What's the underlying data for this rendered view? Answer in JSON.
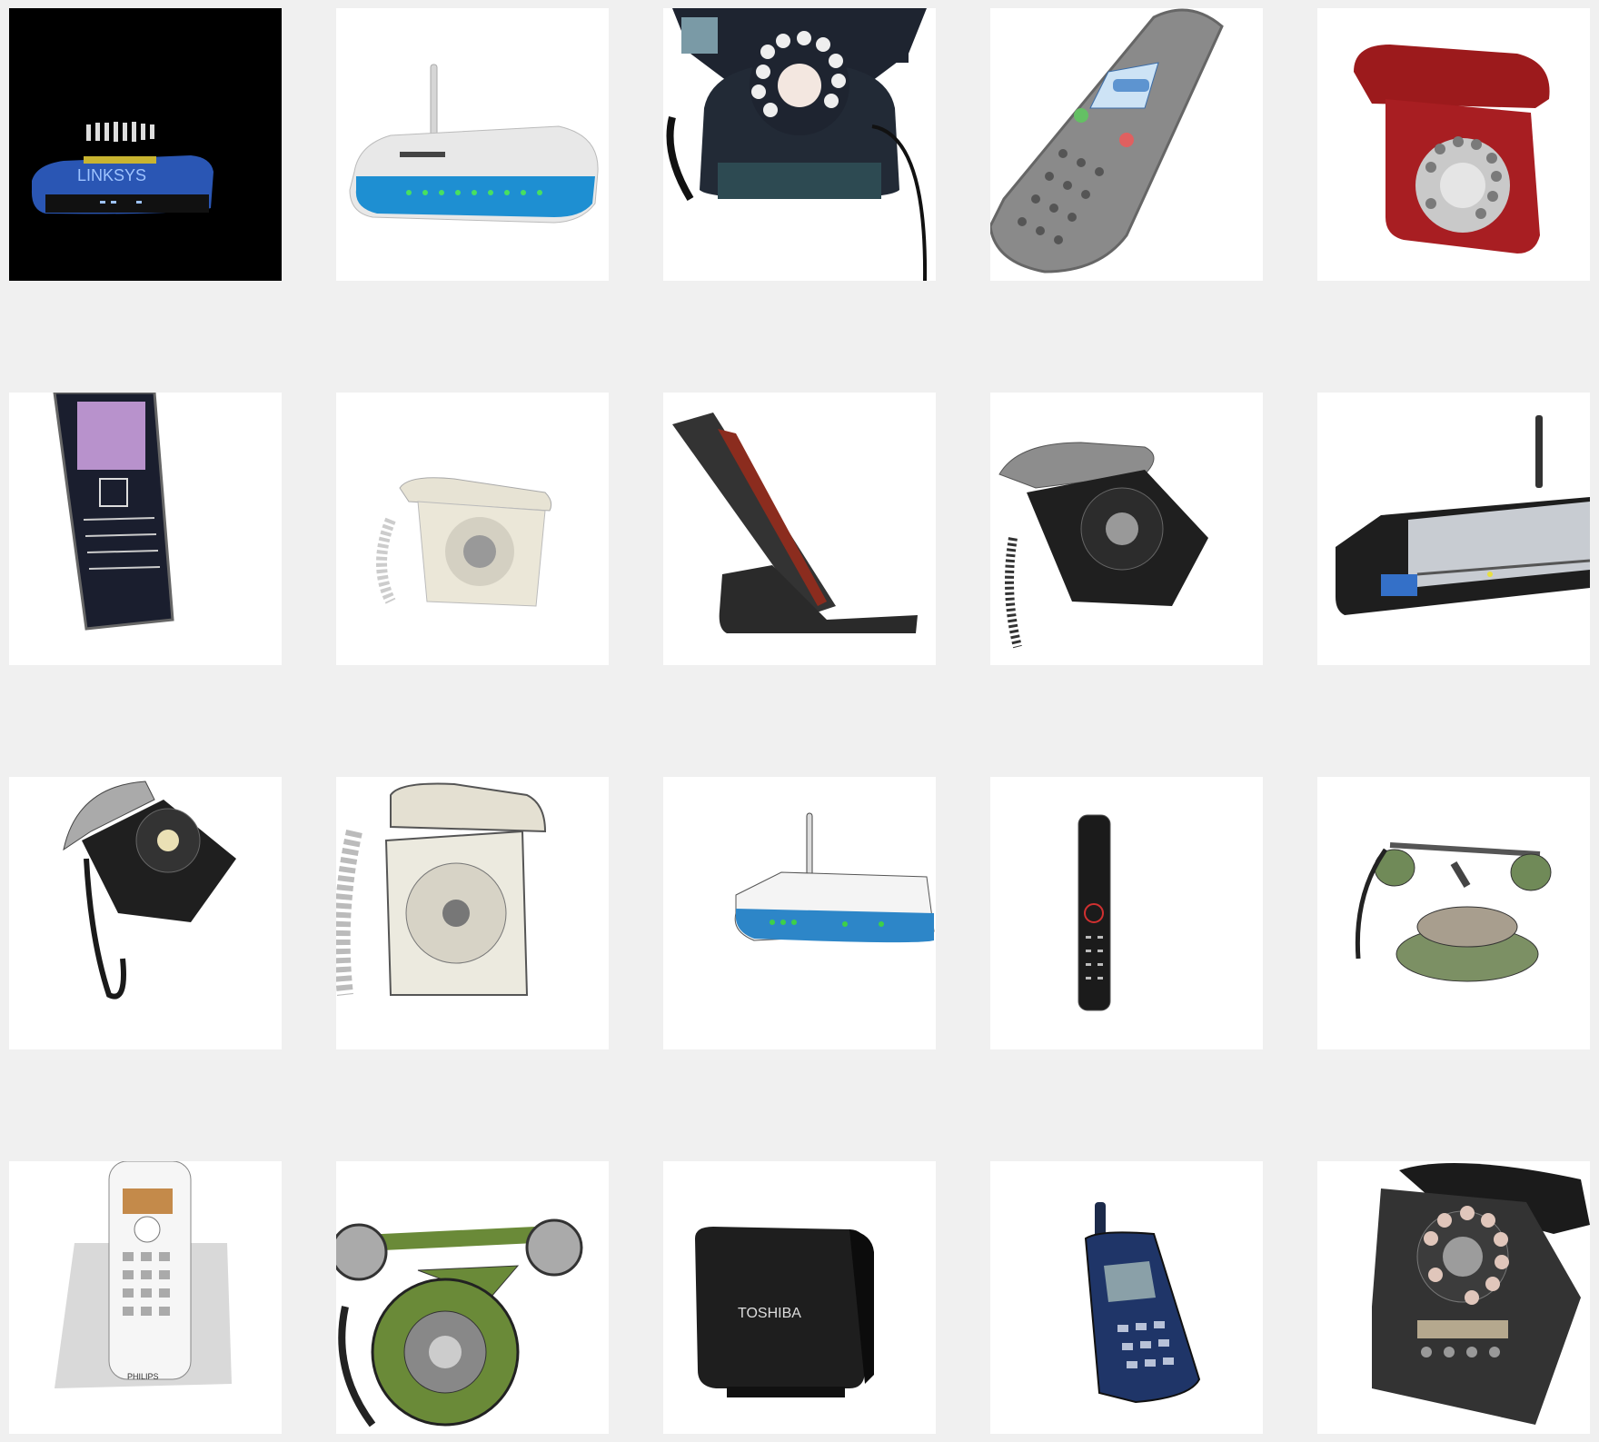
{
  "gallery": {
    "background": "#f0f0f0",
    "tiles": [
      {
        "name": "linksys-router",
        "logo": "LINKSYS",
        "background": "#000000"
      },
      {
        "name": "wifi-router-white",
        "background": "#ffffff"
      },
      {
        "name": "black-rotary-phone",
        "background": "#ffffff"
      },
      {
        "name": "grey-cordless-handset",
        "background": "#ffffff"
      },
      {
        "name": "red-rotary-phone",
        "background": "#ffffff"
      },
      {
        "name": "purple-screen-handset",
        "background": "#ffffff"
      },
      {
        "name": "cream-rotary-phone",
        "background": "#ffffff"
      },
      {
        "name": "cordless-stand",
        "background": "#ffffff"
      },
      {
        "name": "black-rotary-phone-grey-handset",
        "background": "#ffffff"
      },
      {
        "name": "dlink-router",
        "background": "#ffffff"
      },
      {
        "name": "black-rotary-phone-small",
        "background": "#ffffff"
      },
      {
        "name": "cream-rotary-phone-large",
        "background": "#ffffff"
      },
      {
        "name": "blue-wifi-router",
        "background": "#ffffff"
      },
      {
        "name": "black-handset-slim",
        "background": "#ffffff"
      },
      {
        "name": "green-antique-phone",
        "background": "#ffffff"
      },
      {
        "name": "philips-cordless-phone",
        "logo": "PHILIPS",
        "background": "#ffffff"
      },
      {
        "name": "green-candlestick-phone",
        "background": "#ffffff"
      },
      {
        "name": "toshiba-media-box",
        "logo": "TOSHIBA",
        "background": "#ffffff"
      },
      {
        "name": "blue-mobile-phone",
        "background": "#ffffff"
      },
      {
        "name": "black-retro-phone",
        "background": "#ffffff"
      }
    ]
  }
}
